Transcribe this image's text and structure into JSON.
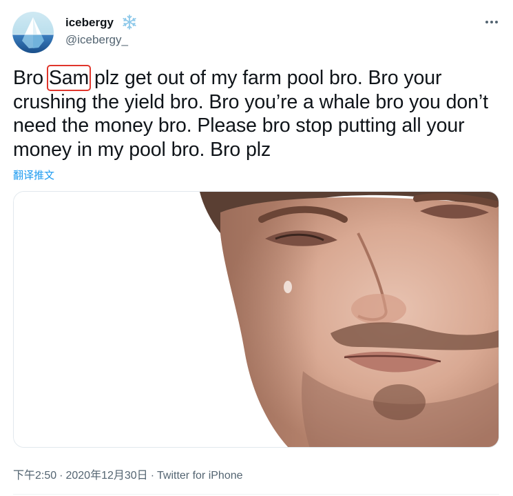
{
  "author": {
    "display_name": "icebergy",
    "name_emoji": "snowflake-icon",
    "handle": "@icebergy_",
    "avatar": "iceberg-avatar"
  },
  "tweet": {
    "text_parts": {
      "before": "Bro ",
      "highlight": "Sam",
      "after": " plz get out of my farm pool bro. Bro your crushing the yield bro. Bro you’re a whale bro you don’t need the money bro. Please bro stop putting all your money in my pool bro. Bro plz"
    },
    "translate_label": "翻译推文",
    "highlight_color": "#e0352b",
    "media": "crying-man-photo"
  },
  "meta": {
    "time": "下午2:50",
    "date": "2020年12月30日",
    "source": "Twitter for iPhone",
    "separator": "·"
  },
  "icons": {
    "more": "more-options-icon"
  },
  "colors": {
    "text": "#0f1419",
    "secondary": "#536471",
    "link": "#1d9bf0"
  }
}
